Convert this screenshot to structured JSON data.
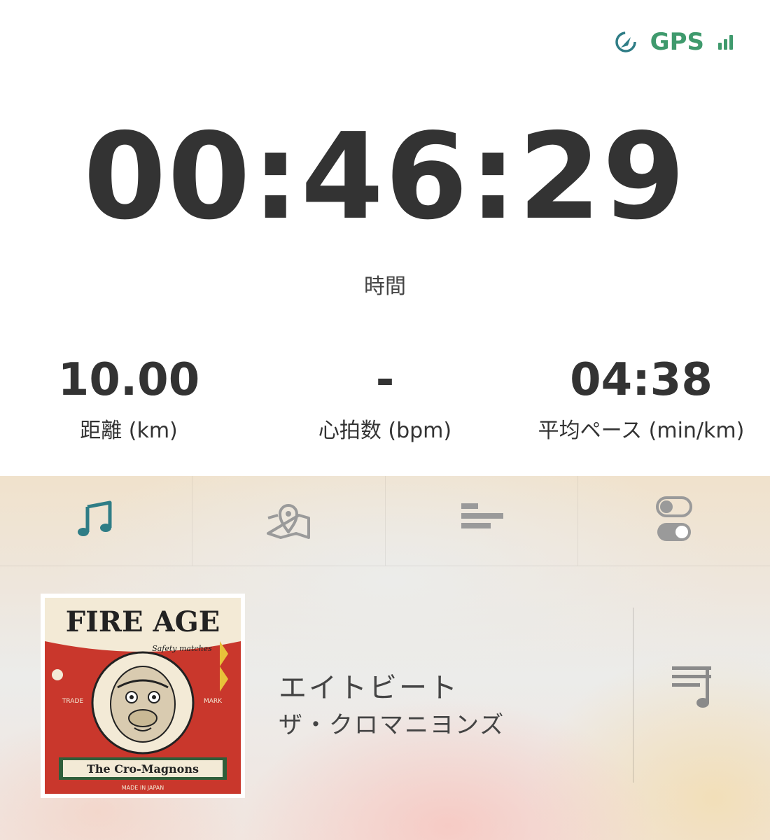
{
  "gps": {
    "label": "GPS"
  },
  "timer": {
    "value": "00:46:29",
    "label": "時間"
  },
  "stats": [
    {
      "value": "10.00",
      "label": "距離 (km)"
    },
    {
      "value": "-",
      "label": "心拍数 (bpm)"
    },
    {
      "value": "04:38",
      "label": "平均ペース (min/km)"
    }
  ],
  "tabs": [
    {
      "icon": "music-note-icon",
      "active": true
    },
    {
      "icon": "map-pin-icon",
      "active": false
    },
    {
      "icon": "bar-list-icon",
      "active": false
    },
    {
      "icon": "toggle-settings-icon",
      "active": false
    }
  ],
  "now_playing": {
    "title": "エイトビート",
    "artist": "ザ・クロマニヨンズ",
    "album_art": {
      "title": "FIRE AGE",
      "subtitle": "Safety matches",
      "trade": "TRADE",
      "mark": "MARK",
      "band": "The Cro-Magnons",
      "made_in": "MADE IN JAPAN"
    }
  },
  "colors": {
    "accent": "#3f9a6d",
    "tab_active": "#2f7d86",
    "tab_inactive": "#9a9a9a",
    "text": "#333333"
  }
}
